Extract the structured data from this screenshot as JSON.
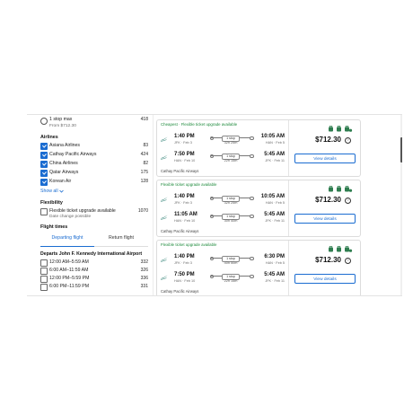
{
  "filters": {
    "stops": {
      "label": "1 stop max",
      "sub": "From $712.30",
      "count": "418"
    },
    "airlines_title": "Airlines",
    "airlines": [
      {
        "name": "Asiana Airlines",
        "count": "83"
      },
      {
        "name": "Cathay Pacific Airways",
        "count": "424"
      },
      {
        "name": "China Airlines",
        "count": "82"
      },
      {
        "name": "Qatar Airways",
        "count": "175"
      },
      {
        "name": "Korean Air",
        "count": "128"
      }
    ],
    "show_all": "Show all",
    "flexibility_title": "Flexibility",
    "flex_option": {
      "label": "Flexible ticket upgrade available",
      "sub": "Date change possible",
      "count": "1070"
    },
    "flight_times_title": "Flight times",
    "tabs": [
      "Departing flight",
      "Return flight"
    ],
    "departs_title": "Departs John F. Kennedy International Airport",
    "time_slots": [
      {
        "label": "12:00 AM–5:59 AM",
        "count": "332"
      },
      {
        "label": "6:00 AM–11:59 AM",
        "count": "326"
      },
      {
        "label": "12:00 PM–5:59 PM",
        "count": "336"
      },
      {
        "label": "6:00 PM–11:59 PM",
        "count": "331"
      }
    ]
  },
  "results": [
    {
      "tag": "Cheapest · Flexible ticket upgrade available",
      "legs": [
        {
          "dep": "1:40 PM",
          "dep_sub": "JFK · Feb 3",
          "stops": "1 stop",
          "dur": "32h 25m",
          "arr": "10:05 AM",
          "arr_sub": "HAN · Feb 5"
        },
        {
          "dep": "7:50 PM",
          "dep_sub": "HAN · Feb 10",
          "stops": "1 stop",
          "dur": "22h 15m",
          "arr": "5:45 AM",
          "arr_sub": "JFK · Feb 11"
        }
      ],
      "airline": "Cathay Pacific Airways",
      "price": "$712.30",
      "button": "View details"
    },
    {
      "tag": "Flexible ticket upgrade available",
      "legs": [
        {
          "dep": "1:40 PM",
          "dep_sub": "JFK · Feb 3",
          "stops": "1 stop",
          "dur": "32h 25m",
          "arr": "10:05 AM",
          "arr_sub": "HAN · Feb 5"
        },
        {
          "dep": "11:05 AM",
          "dep_sub": "HAN · Feb 10",
          "stops": "1 stop",
          "dur": "30h 40m",
          "arr": "5:45 AM",
          "arr_sub": "JFK · Feb 11"
        }
      ],
      "airline": "Cathay Pacific Airways",
      "price": "$712.30",
      "button": "View details"
    },
    {
      "tag": "Flexible ticket upgrade available",
      "legs": [
        {
          "dep": "1:40 PM",
          "dep_sub": "JFK · Feb 3",
          "stops": "1 stop",
          "dur": "40h 50m",
          "arr": "6:30 PM",
          "arr_sub": "HAN · Feb 5"
        },
        {
          "dep": "7:50 PM",
          "dep_sub": "HAN · Feb 10",
          "stops": "1 stop",
          "dur": "22h 15m",
          "arr": "5:45 AM",
          "arr_sub": "JFK · Feb 11"
        }
      ],
      "airline": "Cathay Pacific Airways",
      "price": "$712.30",
      "button": "View details"
    }
  ],
  "colors": {
    "accent": "#1a6cd1",
    "tag_green": "#1e8a3c",
    "eco_green": "#2e7d4f",
    "logo": "#0a6b5c"
  }
}
